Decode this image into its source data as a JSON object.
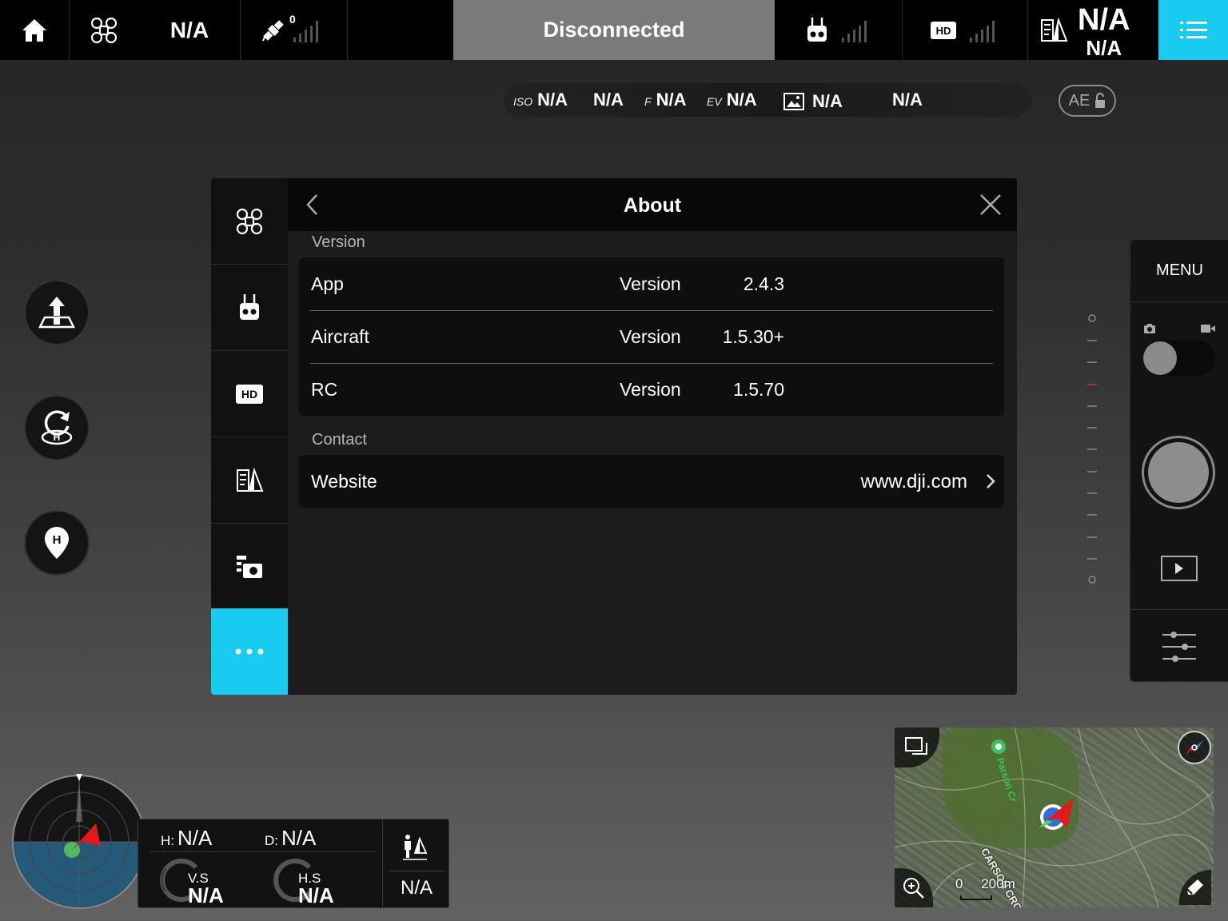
{
  "topbar": {
    "flight_mode": "N/A",
    "gps_count": "0",
    "status": "Disconnected",
    "right_mode_top": "N/A",
    "right_mode_bottom": "N/A"
  },
  "camera": {
    "iso_label": "ISO",
    "iso": "N/A",
    "shutter": "N/A",
    "f_label": "F",
    "aperture": "N/A",
    "ev_label": "EV",
    "ev": "N/A",
    "format": "N/A",
    "remaining": "N/A",
    "ae_label": "AE"
  },
  "panel": {
    "title": "About",
    "version_section": "Version",
    "version_rows": [
      {
        "name": "App",
        "label": "Version",
        "value": "2.4.3"
      },
      {
        "name": "Aircraft",
        "label": "Version",
        "value": "1.5.30+"
      },
      {
        "name": "RC",
        "label": "Version",
        "value": "1.5.70"
      }
    ],
    "contact_section": "Contact",
    "website_name": "Website",
    "website_value": "www.dji.com"
  },
  "right_panel": {
    "menu_label": "MENU"
  },
  "telemetry": {
    "h_label": "H:",
    "h_value": "N/A",
    "d_label": "D:",
    "d_value": "N/A",
    "vs_label": "V.S",
    "vs_value": "N/A",
    "hs_label": "H.S",
    "hs_value": "N/A",
    "dist_value": "N/A"
  },
  "map": {
    "road1": "Parson Cr",
    "road2": "CARSON CROSS",
    "scale_zero": "0",
    "scale_value": "200m"
  },
  "colors": {
    "accent": "#18cbf0",
    "status_bg": "#7a7a7a"
  }
}
